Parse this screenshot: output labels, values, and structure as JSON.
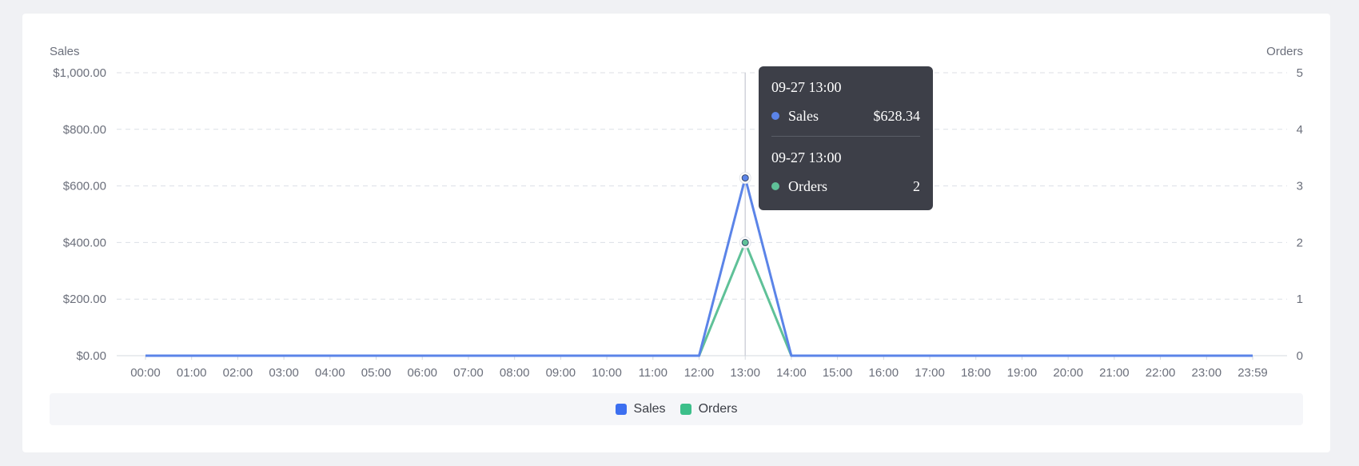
{
  "chart_data": {
    "type": "line",
    "ylabel_left": "Sales",
    "ylabel_right": "Orders",
    "x": [
      "00:00",
      "01:00",
      "02:00",
      "03:00",
      "04:00",
      "05:00",
      "06:00",
      "07:00",
      "08:00",
      "09:00",
      "10:00",
      "11:00",
      "12:00",
      "13:00",
      "14:00",
      "15:00",
      "16:00",
      "17:00",
      "18:00",
      "19:00",
      "20:00",
      "21:00",
      "22:00",
      "23:00",
      "23:59"
    ],
    "yticks_left": [
      "$0.00",
      "$200.00",
      "$400.00",
      "$600.00",
      "$800.00",
      "$1,000.00"
    ],
    "yticks_right": [
      "0",
      "1",
      "2",
      "3",
      "4",
      "5"
    ],
    "ylim_left": [
      0,
      1000
    ],
    "ylim_right": [
      0,
      5
    ],
    "grid": true,
    "legend_position": "bottom-center",
    "series": [
      {
        "name": "Sales",
        "axis": "left",
        "color": "#5b84e8",
        "values": [
          0,
          0,
          0,
          0,
          0,
          0,
          0,
          0,
          0,
          0,
          0,
          0,
          0,
          628.34,
          0,
          0,
          0,
          0,
          0,
          0,
          0,
          0,
          0,
          0,
          0
        ]
      },
      {
        "name": "Orders",
        "axis": "right",
        "color": "#5fc198",
        "values": [
          0,
          0,
          0,
          0,
          0,
          0,
          0,
          0,
          0,
          0,
          0,
          0,
          0,
          2,
          0,
          0,
          0,
          0,
          0,
          0,
          0,
          0,
          0,
          0,
          0
        ]
      }
    ]
  },
  "legend": {
    "sales_label": "Sales",
    "sales_color": "#3c6ff0",
    "orders_label": "Orders",
    "orders_color": "#3cbf8a"
  },
  "tooltip": {
    "sales_time": "09-27 13:00",
    "sales_name": "Sales",
    "sales_value": "$628.34",
    "orders_time": "09-27 13:00",
    "orders_name": "Orders",
    "orders_value": "2"
  }
}
